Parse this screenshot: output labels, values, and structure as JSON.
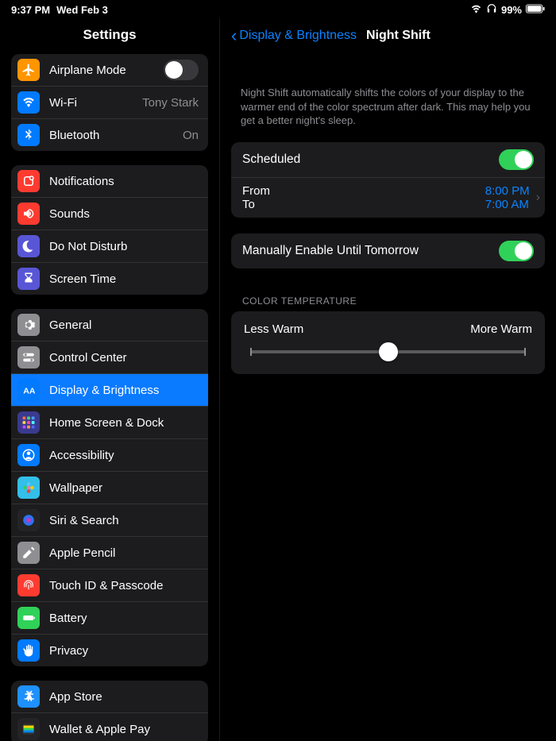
{
  "status": {
    "time": "9:37 PM",
    "date": "Wed Feb 3",
    "battery": "99%"
  },
  "sidebar_title": "Settings",
  "groups": [
    {
      "items": [
        {
          "id": "airplane",
          "label": "Airplane Mode",
          "icon": "airplane",
          "color": "#ff9500",
          "toggle": false
        },
        {
          "id": "wifi",
          "label": "Wi-Fi",
          "icon": "wifi",
          "color": "#007aff",
          "detail": "Tony Stark"
        },
        {
          "id": "bluetooth",
          "label": "Bluetooth",
          "icon": "bluetooth",
          "color": "#007aff",
          "detail": "On"
        }
      ]
    },
    {
      "items": [
        {
          "id": "notifications",
          "label": "Notifications",
          "icon": "bell",
          "color": "#ff3b30"
        },
        {
          "id": "sounds",
          "label": "Sounds",
          "icon": "speaker",
          "color": "#ff3b30"
        },
        {
          "id": "dnd",
          "label": "Do Not Disturb",
          "icon": "moon",
          "color": "#5856d6"
        },
        {
          "id": "screentime",
          "label": "Screen Time",
          "icon": "hourglass",
          "color": "#5856d6"
        }
      ]
    },
    {
      "items": [
        {
          "id": "general",
          "label": "General",
          "icon": "gear",
          "color": "#8e8e93"
        },
        {
          "id": "cc",
          "label": "Control Center",
          "icon": "switches",
          "color": "#8e8e93"
        },
        {
          "id": "display",
          "label": "Display & Brightness",
          "icon": "aa",
          "color": "#007aff",
          "selected": true
        },
        {
          "id": "home",
          "label": "Home Screen & Dock",
          "icon": "grid",
          "color": "#3a3a8f"
        },
        {
          "id": "accessibility",
          "label": "Accessibility",
          "icon": "person",
          "color": "#007aff"
        },
        {
          "id": "wallpaper",
          "label": "Wallpaper",
          "icon": "flower",
          "color": "#33bfe8"
        },
        {
          "id": "siri",
          "label": "Siri & Search",
          "icon": "siri",
          "color": "#242426"
        },
        {
          "id": "pencil",
          "label": "Apple Pencil",
          "icon": "pencil",
          "color": "#8e8e93"
        },
        {
          "id": "touchid",
          "label": "Touch ID & Passcode",
          "icon": "fingerprint",
          "color": "#ff3b30"
        },
        {
          "id": "battery",
          "label": "Battery",
          "icon": "battery",
          "color": "#30d158"
        },
        {
          "id": "privacy",
          "label": "Privacy",
          "icon": "hand",
          "color": "#007aff"
        }
      ]
    },
    {
      "items": [
        {
          "id": "appstore",
          "label": "App Store",
          "icon": "appstore",
          "color": "#1e90ff"
        },
        {
          "id": "wallet",
          "label": "Wallet & Apple Pay",
          "icon": "wallet",
          "color": "#242426"
        }
      ]
    }
  ],
  "detail": {
    "back_label": "Display & Brightness",
    "title": "Night Shift",
    "description": "Night Shift automatically shifts the colors of your display to the warmer end of the color spectrum after dark. This may help you get a better night's sleep.",
    "scheduled_label": "Scheduled",
    "scheduled_on": true,
    "from_label": "From",
    "from_value": "8:00 PM",
    "to_label": "To",
    "to_value": "7:00 AM",
    "manual_label": "Manually Enable Until Tomorrow",
    "manual_on": true,
    "temp_header": "COLOR TEMPERATURE",
    "less_warm": "Less Warm",
    "more_warm": "More Warm",
    "slider_pct": 50
  }
}
